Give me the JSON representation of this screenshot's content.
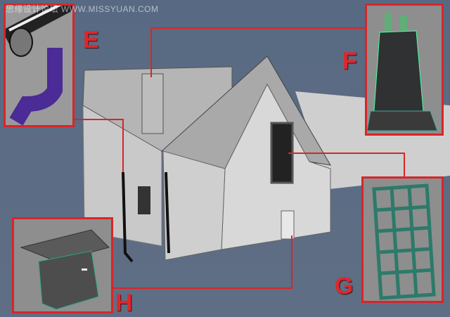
{
  "watermark": "思缘设计论坛 WWW.MISSYUAN.COM",
  "callouts": {
    "e": "E",
    "f": "F",
    "g": "G",
    "h": "H"
  },
  "colors": {
    "accent": "#d8252a",
    "background": "#5b6b82"
  }
}
